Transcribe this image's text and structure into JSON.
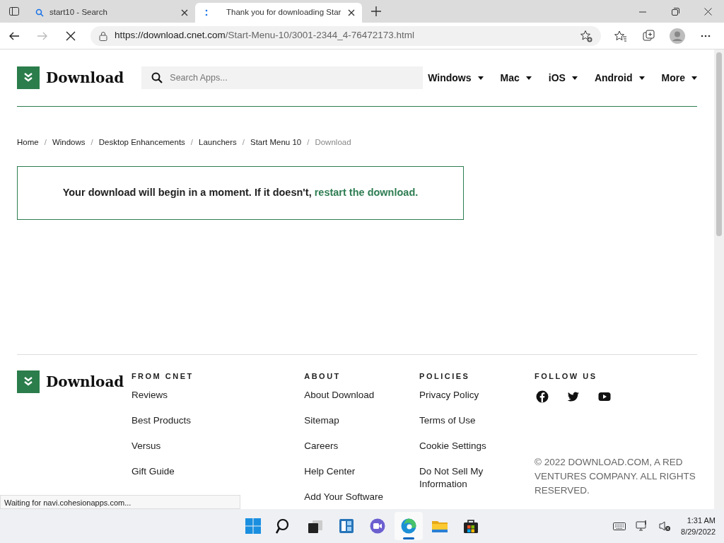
{
  "browser": {
    "tabs": [
      {
        "title": "start10 - Search",
        "kind": "search",
        "selected": false
      },
      {
        "title": "Thank you for downloading Star",
        "kind": "loading",
        "selected": true
      }
    ],
    "url": {
      "host": "https://download.cnet.com",
      "path": "/Start-Menu-10/3001-2344_4-76472173.html"
    },
    "status": "Waiting for navi.cohesionapps.com..."
  },
  "header": {
    "logo": "Download",
    "search_placeholder": "Search Apps...",
    "nav": [
      "Windows",
      "Mac",
      "iOS",
      "Android",
      "More"
    ]
  },
  "breadcrumb": [
    {
      "label": "Home",
      "current": false
    },
    {
      "separator": "/",
      "label": "Windows",
      "current": false
    },
    {
      "separator": "/",
      "label": "Desktop Enhancements",
      "current": false
    },
    {
      "separator": "/",
      "label": "Launchers",
      "current": false
    },
    {
      "separator": "/",
      "label": "Start Menu 10",
      "current": false
    },
    {
      "separator": "/",
      "label": "Download",
      "current": true
    }
  ],
  "message": {
    "text": "Your download will begin in a moment. If it doesn't,",
    "link": "restart the download."
  },
  "footer": {
    "logo": "Download",
    "columns": [
      {
        "heading": "FROM CNET",
        "links": [
          "Reviews",
          "Best Products",
          "Versus",
          "Gift Guide"
        ]
      },
      {
        "heading": "ABOUT",
        "links": [
          "About Download",
          "Sitemap",
          "Careers",
          "Help Center",
          "Add Your Software"
        ]
      },
      {
        "heading": "POLICIES",
        "links": [
          "Privacy Policy",
          "Terms of Use",
          "Cookie Settings",
          "Do Not Sell My Information"
        ]
      }
    ],
    "follow": {
      "heading": "FOLLOW US",
      "social": [
        {
          "kind": "facebook"
        },
        {
          "kind": "twitter"
        },
        {
          "kind": "youtube"
        }
      ]
    },
    "copyright": "© 2022 DOWNLOAD.COM, A RED VENTURES COMPANY. ALL RIGHTS RESERVED."
  },
  "taskbar": {
    "apps": [
      {
        "kind": "start",
        "selected": false
      },
      {
        "kind": "search",
        "selected": false
      },
      {
        "kind": "taskview",
        "selected": false
      },
      {
        "kind": "widgets",
        "selected": false
      },
      {
        "kind": "chat",
        "selected": false
      },
      {
        "kind": "edge",
        "selected": true
      },
      {
        "kind": "explorer",
        "selected": false
      },
      {
        "kind": "store",
        "selected": false
      }
    ],
    "time": "1:31 AM",
    "date": "8/29/2022"
  }
}
